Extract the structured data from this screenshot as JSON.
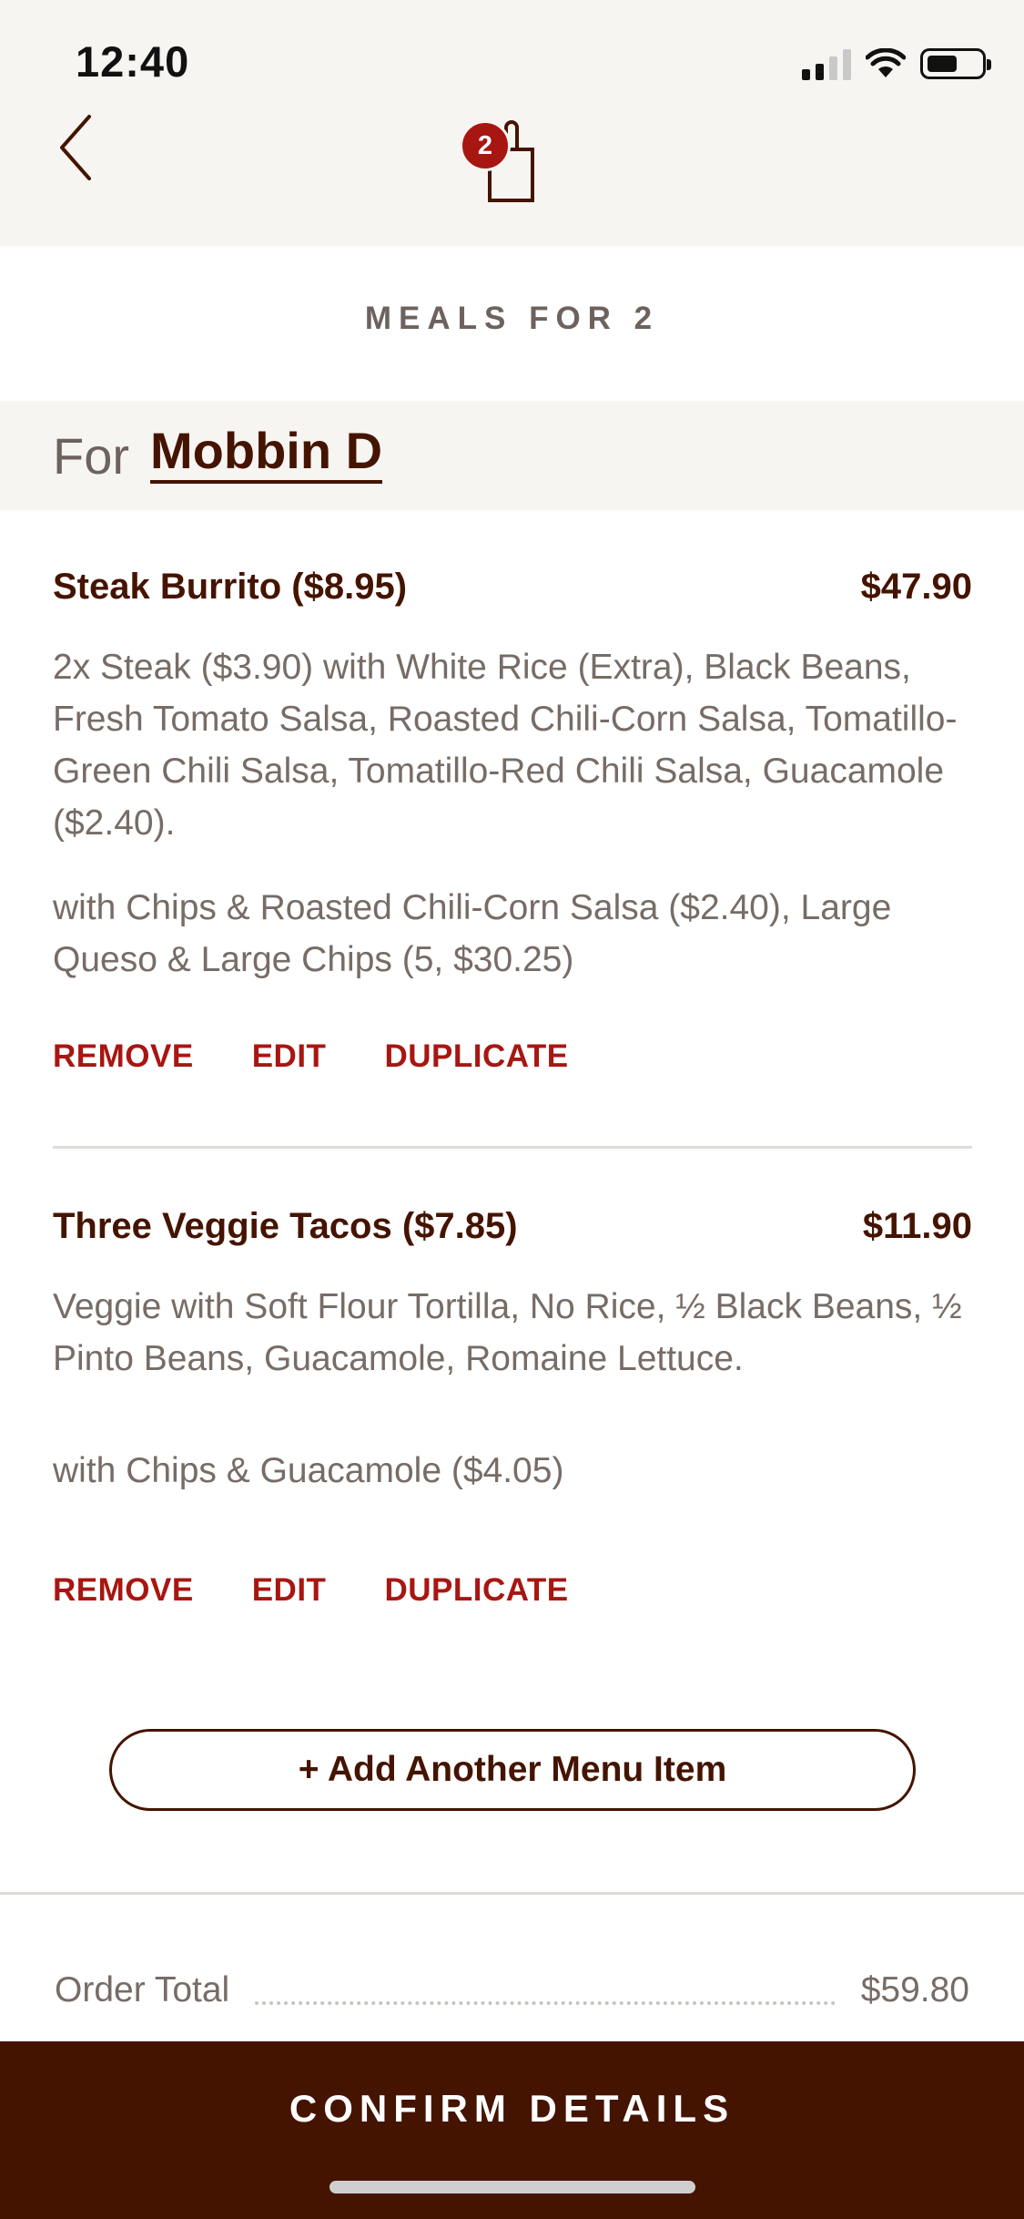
{
  "status_bar": {
    "time": "12:40"
  },
  "header": {
    "bag_count": "2"
  },
  "meal": {
    "title": "MEALS FOR 2",
    "for_label": "For",
    "for_name": "Mobbin D"
  },
  "items": [
    {
      "name": "Steak Burrito ($8.95)",
      "price": "$47.90",
      "description": "2x Steak ($3.90) with White Rice (Extra), Black Beans, Fresh Tomato Salsa, Roasted Chili-Corn Salsa, Tomatillo-Green Chili Salsa, Tomatillo-Red Chili Salsa, Guacamole ($2.40).",
      "sides": "with Chips & Roasted Chili-Corn Salsa ($2.40), Large Queso & Large Chips (5, $30.25)"
    },
    {
      "name": "Three Veggie Tacos ($7.85)",
      "price": "$11.90",
      "description": "Veggie with Soft Flour Tortilla, No Rice, ½ Black Beans, ½ Pinto Beans, Guacamole, Romaine Lettuce.",
      "sides": "with Chips & Guacamole ($4.05)"
    }
  ],
  "actions": {
    "remove": "REMOVE",
    "edit": "EDIT",
    "duplicate": "DUPLICATE"
  },
  "add_item_label": "+ Add Another Menu Item",
  "order_total": {
    "label": "Order Total",
    "value": "$59.80"
  },
  "confirm_label": "CONFIRM DETAILS",
  "colors": {
    "brand": "#451400",
    "accent": "#a81612",
    "band": "#f7f5f2",
    "muted": "#776c66"
  },
  "icons": {
    "back": "chevron-left-icon",
    "bag": "shopping-bag-icon"
  }
}
